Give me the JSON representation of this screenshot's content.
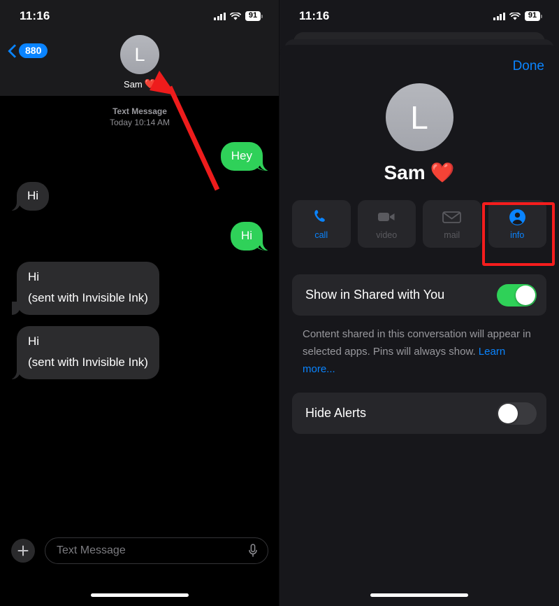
{
  "statusbar": {
    "time": "11:16",
    "battery": "91",
    "signal_icon": "cellular-bars-icon",
    "wifi_icon": "wifi-icon",
    "battery_icon": "battery-icon"
  },
  "left_phone": {
    "nav": {
      "back_icon": "chevron-left-icon",
      "back_badge": "880",
      "avatar_initial": "L",
      "contact_name": "Sam",
      "contact_emoji": "❤️"
    },
    "thread": {
      "stamp_type": "Text Message",
      "stamp_time": "Today 10:14 AM",
      "messages": [
        {
          "side": "out",
          "style": "green",
          "text": "Hey"
        },
        {
          "side": "in",
          "style": "gray",
          "text": "Hi"
        },
        {
          "side": "out",
          "style": "green",
          "text": "Hi"
        },
        {
          "side": "in",
          "style": "gray",
          "text": "Hi",
          "note": "(sent with Invisible Ink)"
        },
        {
          "side": "in",
          "style": "gray",
          "text": "Hi",
          "note": "(sent with Invisible Ink)"
        }
      ]
    },
    "composer": {
      "add_icon": "plus-icon",
      "placeholder": "Text Message",
      "mic_icon": "microphone-icon"
    }
  },
  "right_phone": {
    "done_label": "Done",
    "avatar_initial": "L",
    "contact_name": "Sam",
    "contact_emoji": "❤️",
    "actions": [
      {
        "label": "call",
        "icon": "phone-icon",
        "enabled": true
      },
      {
        "label": "video",
        "icon": "video-camera-icon",
        "enabled": false
      },
      {
        "label": "mail",
        "icon": "envelope-icon",
        "enabled": false
      },
      {
        "label": "info",
        "icon": "person-circle-icon",
        "enabled": true
      }
    ],
    "settings": [
      {
        "label": "Show in Shared with You",
        "toggle": "on"
      },
      {
        "label": "Hide Alerts",
        "toggle": "off"
      }
    ],
    "footnote": "Content shared in this conversation will appear in selected apps. Pins will always show.",
    "footnote_link": "Learn more..."
  },
  "annotations": {
    "arrow_color": "#ee1c1c",
    "highlight_color": "#f51d1d",
    "arrow_target": "contact-avatar-left",
    "highlight_target": "info-action-button"
  },
  "colors": {
    "accent_blue": "#0a84ff",
    "bubble_green": "#2fd159",
    "bubble_gray": "#2c2c2e",
    "toggle_on": "#2fd158",
    "sheet_bg": "#17171b",
    "card_bg": "#26262a"
  }
}
